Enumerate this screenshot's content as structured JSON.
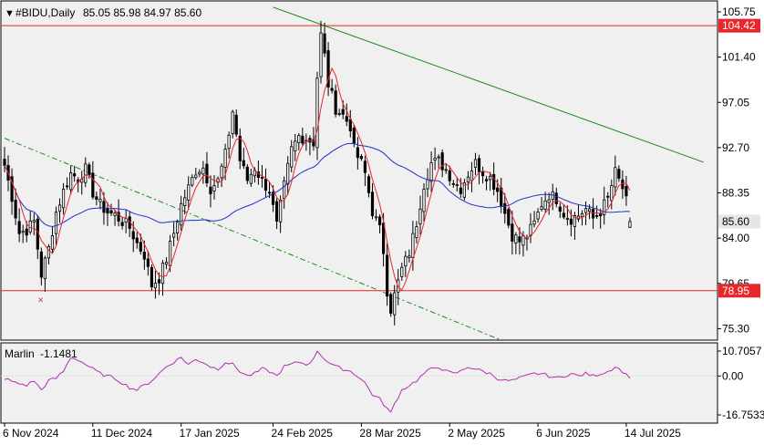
{
  "header": {
    "symbol_label": "#BIDU,Daily",
    "ohlc_label": "85.05 85.98 84.97 85.60",
    "dropdown_glyph": "▼"
  },
  "price_axis": {
    "ticks": [
      {
        "value": 105.75,
        "label": "105.75"
      },
      {
        "value": 101.4,
        "label": "101.40"
      },
      {
        "value": 97.05,
        "label": "97.05"
      },
      {
        "value": 92.7,
        "label": "92.70"
      },
      {
        "value": 88.35,
        "label": "88.35"
      },
      {
        "value": 84.0,
        "label": "84.00"
      },
      {
        "value": 79.65,
        "label": "79.65"
      },
      {
        "value": 75.3,
        "label": "75.30"
      }
    ],
    "ylim": [
      74.2,
      106.8
    ]
  },
  "levels": {
    "resistance": {
      "value": 104.42,
      "label": "104.42",
      "color": "#e8262b"
    },
    "support": {
      "value": 78.95,
      "label": "78.95",
      "color": "#e8262b"
    },
    "current": {
      "value": 85.6,
      "label": "85.60",
      "box_color": "#e6e6e6"
    }
  },
  "indicator": {
    "name": "Marlin",
    "value_label": "-1.1481",
    "ticks": [
      {
        "value": 10.7057,
        "label": "10.7057"
      },
      {
        "value": 0.0,
        "label": "0.00"
      },
      {
        "value": -16.7533,
        "label": "-16.7533"
      }
    ],
    "color": "#b030b0"
  },
  "time_axis": {
    "labels": [
      {
        "index": 0,
        "label": "6 Nov 2024"
      },
      {
        "index": 24,
        "label": "11 Dec 2024"
      },
      {
        "index": 48,
        "label": "17 Jan 2025"
      },
      {
        "index": 73,
        "label": "24 Feb 2025"
      },
      {
        "index": 97,
        "label": "28 Mar 2025"
      },
      {
        "index": 121,
        "label": "2 May 2025"
      },
      {
        "index": 145,
        "label": "6 Jun 2025"
      },
      {
        "index": 169,
        "label": "14 Jul 2025"
      }
    ]
  },
  "colors": {
    "background": "#ffffff",
    "plot_background": "#f0f0f0",
    "candles": "#000000",
    "fast_ma": "#e8262b",
    "slow_ma": "#2030c8",
    "trend_lines": "#1a8f1a",
    "marker": "#e8262b"
  },
  "chart_data": {
    "type": "candlestick",
    "start_date": "2024-11-06",
    "anchor_points": [
      [
        0,
        91
      ],
      [
        2,
        88
      ],
      [
        4,
        84.5
      ],
      [
        6,
        84.8
      ],
      [
        8,
        85.6
      ],
      [
        10,
        80.5
      ],
      [
        12,
        83
      ],
      [
        14,
        86.5
      ],
      [
        16,
        88.5
      ],
      [
        18,
        90.2
      ],
      [
        20,
        89.8
      ],
      [
        22,
        90.6
      ],
      [
        24,
        88.4
      ],
      [
        26,
        87.2
      ],
      [
        28,
        86.5
      ],
      [
        30,
        86.2
      ],
      [
        32,
        85.6
      ],
      [
        34,
        85
      ],
      [
        36,
        83.5
      ],
      [
        38,
        82.4
      ],
      [
        40,
        79.5
      ],
      [
        42,
        80.2
      ],
      [
        44,
        82
      ],
      [
        46,
        84.5
      ],
      [
        48,
        87.2
      ],
      [
        50,
        88.8
      ],
      [
        52,
        90.5
      ],
      [
        54,
        90.8
      ],
      [
        56,
        88.8
      ],
      [
        58,
        89.5
      ],
      [
        60,
        92
      ],
      [
        62,
        96.2
      ],
      [
        63,
        94
      ],
      [
        64,
        91.5
      ],
      [
        66,
        89.6
      ],
      [
        68,
        90.8
      ],
      [
        70,
        89.5
      ],
      [
        72,
        88.6
      ],
      [
        74,
        85.2
      ],
      [
        76,
        89
      ],
      [
        78,
        92.5
      ],
      [
        80,
        93.8
      ],
      [
        82,
        93.6
      ],
      [
        84,
        93.2
      ],
      [
        85,
        99.5
      ],
      [
        86,
        103.5
      ],
      [
        87,
        101.5
      ],
      [
        88,
        98.8
      ],
      [
        90,
        96.5
      ],
      [
        92,
        95.8
      ],
      [
        94,
        94.8
      ],
      [
        95,
        92.5
      ],
      [
        96,
        91.8
      ],
      [
        97,
        91.2
      ],
      [
        98,
        90.2
      ],
      [
        100,
        86.6
      ],
      [
        102,
        84.8
      ],
      [
        103,
        82.8
      ],
      [
        104,
        79
      ],
      [
        105,
        77.2
      ],
      [
        106,
        78.5
      ],
      [
        108,
        81
      ],
      [
        110,
        82.6
      ],
      [
        112,
        85.5
      ],
      [
        114,
        89.2
      ],
      [
        116,
        91.2
      ],
      [
        118,
        91.4
      ],
      [
        120,
        90.6
      ],
      [
        122,
        89.5
      ],
      [
        124,
        88.8
      ],
      [
        126,
        90.2
      ],
      [
        128,
        91.2
      ],
      [
        130,
        90.4
      ],
      [
        132,
        89.8
      ],
      [
        134,
        88.6
      ],
      [
        136,
        86.4
      ],
      [
        138,
        84.3
      ],
      [
        140,
        83.7
      ],
      [
        142,
        84.2
      ],
      [
        144,
        85.4
      ],
      [
        146,
        87.3
      ],
      [
        148,
        88.2
      ],
      [
        150,
        87.8
      ],
      [
        152,
        86.4
      ],
      [
        154,
        85.9
      ],
      [
        156,
        86.2
      ],
      [
        158,
        86.8
      ],
      [
        160,
        85.9
      ],
      [
        162,
        86.6
      ],
      [
        164,
        87.8
      ],
      [
        166,
        90.3
      ],
      [
        168,
        88.8
      ],
      [
        169,
        87.5
      ],
      [
        170,
        85.6
      ]
    ],
    "last_bar": {
      "open": 85.05,
      "high": 85.98,
      "low": 84.97,
      "close": 85.6
    },
    "fast_ma_period": 5,
    "slow_ma_period": 34,
    "trend_lines": [
      {
        "style": "solid",
        "from": [
          73,
          106.2
        ],
        "to": [
          190,
          91.3
        ]
      },
      {
        "style": "dashed",
        "from": [
          0,
          93.6
        ],
        "to": [
          135,
          74.2
        ]
      }
    ],
    "marker": {
      "index": 10,
      "value": 78.1,
      "glyph": "×"
    },
    "indicator_anchor_points": [
      [
        0,
        -1
      ],
      [
        3,
        -3
      ],
      [
        6,
        -4
      ],
      [
        8,
        -2
      ],
      [
        10,
        -6
      ],
      [
        12,
        -2
      ],
      [
        14,
        -1
      ],
      [
        16,
        2
      ],
      [
        18,
        8
      ],
      [
        20,
        7
      ],
      [
        22,
        5
      ],
      [
        24,
        3
      ],
      [
        26,
        1
      ],
      [
        28,
        0
      ],
      [
        30,
        -1
      ],
      [
        32,
        -3
      ],
      [
        34,
        -5
      ],
      [
        36,
        -6
      ],
      [
        38,
        -4
      ],
      [
        40,
        -2
      ],
      [
        42,
        1
      ],
      [
        44,
        4
      ],
      [
        46,
        6
      ],
      [
        48,
        8
      ],
      [
        50,
        5
      ],
      [
        52,
        7
      ],
      [
        54,
        6
      ],
      [
        56,
        4
      ],
      [
        58,
        3
      ],
      [
        60,
        6
      ],
      [
        62,
        5
      ],
      [
        64,
        2
      ],
      [
        66,
        0
      ],
      [
        68,
        1
      ],
      [
        70,
        3
      ],
      [
        72,
        2
      ],
      [
        74,
        0
      ],
      [
        76,
        4
      ],
      [
        78,
        5
      ],
      [
        80,
        6
      ],
      [
        82,
        5
      ],
      [
        84,
        7
      ],
      [
        85,
        11
      ],
      [
        86,
        9
      ],
      [
        88,
        6
      ],
      [
        90,
        4
      ],
      [
        92,
        3
      ],
      [
        94,
        2
      ],
      [
        96,
        0
      ],
      [
        98,
        -3
      ],
      [
        100,
        -8
      ],
      [
        102,
        -10
      ],
      [
        104,
        -14
      ],
      [
        105,
        -16
      ],
      [
        106,
        -12
      ],
      [
        108,
        -6
      ],
      [
        110,
        -4
      ],
      [
        112,
        -2
      ],
      [
        114,
        1
      ],
      [
        116,
        3
      ],
      [
        118,
        4
      ],
      [
        120,
        2
      ],
      [
        122,
        1
      ],
      [
        124,
        2
      ],
      [
        126,
        4
      ],
      [
        128,
        3
      ],
      [
        130,
        2
      ],
      [
        132,
        1
      ],
      [
        134,
        -1
      ],
      [
        136,
        -2
      ],
      [
        138,
        -2
      ],
      [
        140,
        -1
      ],
      [
        142,
        0
      ],
      [
        144,
        1
      ],
      [
        146,
        1
      ],
      [
        148,
        0
      ],
      [
        150,
        -1
      ],
      [
        152,
        0
      ],
      [
        154,
        1
      ],
      [
        156,
        0
      ],
      [
        158,
        1
      ],
      [
        160,
        0
      ],
      [
        162,
        1
      ],
      [
        164,
        2
      ],
      [
        166,
        4
      ],
      [
        168,
        2
      ],
      [
        170,
        -1.1
      ]
    ]
  }
}
